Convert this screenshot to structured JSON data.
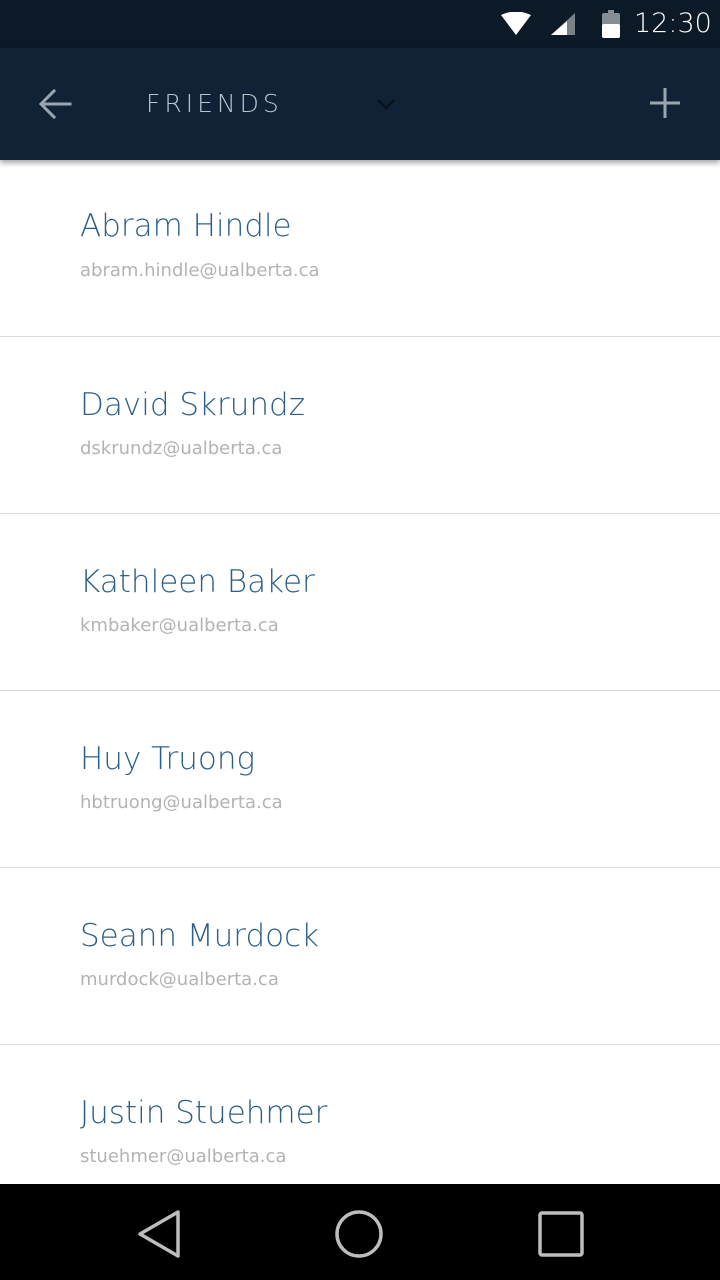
{
  "status_bar": {
    "time": "12:30",
    "icons": [
      "wifi-icon",
      "cell-signal-icon",
      "battery-icon"
    ]
  },
  "app_bar": {
    "title": "FRIENDS",
    "back_icon": "arrow-back-icon",
    "dropdown_icon": "chevron-down-icon",
    "add_icon": "plus-icon"
  },
  "friends": [
    {
      "name": "Abram Hindle",
      "email": "abram.hindle@ualberta.ca"
    },
    {
      "name": "David Skrundz",
      "email": "dskrundz@ualberta.ca"
    },
    {
      "name": "Kathleen Baker",
      "email": "kmbaker@ualberta.ca"
    },
    {
      "name": "Huy Truong",
      "email": "hbtruong@ualberta.ca"
    },
    {
      "name": "Seann Murdock",
      "email": "murdock@ualberta.ca"
    },
    {
      "name": "Justin Stuehmer",
      "email": "stuehmer@ualberta.ca"
    }
  ],
  "nav_bar": {
    "icons": [
      "nav-back-icon",
      "nav-home-icon",
      "nav-recents-icon"
    ]
  },
  "colors": {
    "status_bar_bg": "#0c1a28",
    "app_bar_bg": "#112236",
    "title_text": "#b9c3cc",
    "name_text": "#2c5f87",
    "email_text": "#b3b3b3",
    "divider": "#dadada"
  }
}
